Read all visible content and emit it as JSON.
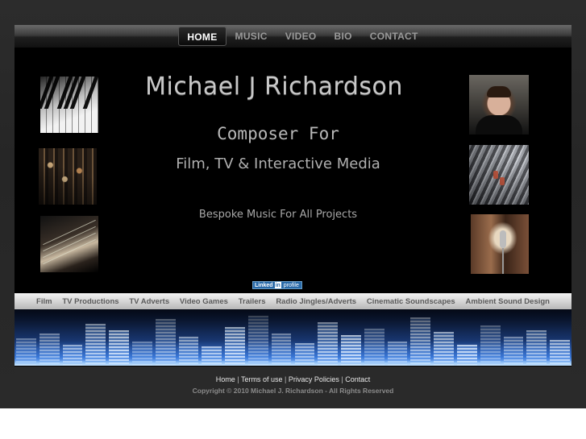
{
  "nav": {
    "items": [
      {
        "label": "HOME",
        "active": true
      },
      {
        "label": "MUSIC",
        "active": false
      },
      {
        "label": "VIDEO",
        "active": false
      },
      {
        "label": "BIO",
        "active": false
      },
      {
        "label": "CONTACT",
        "active": false
      }
    ]
  },
  "hero": {
    "name": "Michael J Richardson",
    "tagline": "Composer For",
    "subtagline": "Film, TV & Interactive Media",
    "bespoke": "Bespoke Music For All Projects"
  },
  "linkedin": {
    "part1": "Linked",
    "part2": "in",
    "part3": "profile"
  },
  "categories": [
    "Film",
    "TV Productions",
    "TV Adverts",
    "Video Games",
    "Trailers",
    "Radio Jingles/Adverts",
    "Cinematic Soundscapes",
    "Ambient Sound Design"
  ],
  "footer": {
    "links": [
      "Home",
      "Terms of use",
      "Privacy Policies",
      "Contact"
    ],
    "separator": "|",
    "copyright": "Copyright © 2010 Michael J. Richardson - All Rights Reserved"
  },
  "colors": {
    "page_background": "#2c2c2c",
    "frame": "#000000",
    "nav_active": "#ffffff",
    "nav_inactive": "#9a9a9a",
    "linkedin_blue": "#2a6aa8"
  },
  "images": [
    {
      "icon": "piano-keys-photo"
    },
    {
      "icon": "mixing-console-photo"
    },
    {
      "icon": "guitar-photo"
    },
    {
      "icon": "composer-portrait-photo"
    },
    {
      "icon": "studio-desk-photo"
    },
    {
      "icon": "microphone-photo"
    }
  ]
}
